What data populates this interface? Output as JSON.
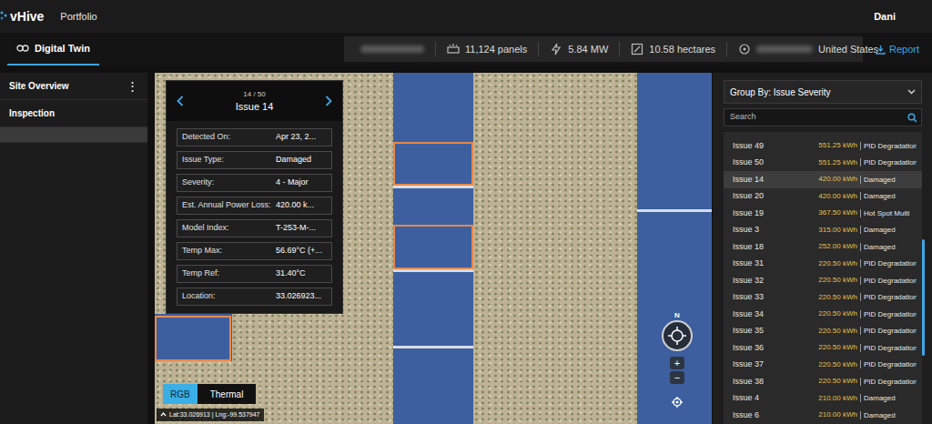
{
  "header": {
    "logo": "vHive",
    "nav": "Portfolio",
    "user": "Dani"
  },
  "toolbar": {
    "tab": {
      "label": "Digital Twin",
      "selected": true
    },
    "stats": [
      {
        "kind": "panels",
        "text": "11,124 panels"
      },
      {
        "kind": "power",
        "text": "5.84 MW"
      },
      {
        "kind": "area",
        "text": "10.58 hectares"
      },
      {
        "kind": "location",
        "text": "United States"
      }
    ],
    "report": "Report"
  },
  "sidebar": {
    "menu": "⋮",
    "items": [
      {
        "label": "Site Overview",
        "selected": false
      },
      {
        "label": "Inspection",
        "selected": false
      },
      {
        "label": "",
        "selected": true
      }
    ]
  },
  "issue_card": {
    "counter": "14 / 50",
    "title": "Issue 14",
    "fields": [
      {
        "label": "Detected On:",
        "value": "Apr 23, 2..."
      },
      {
        "label": "Issue Type:",
        "value": "Damaged"
      },
      {
        "label": "Severity:",
        "value": "4 - Major"
      },
      {
        "label": "Est. Annual Power Loss:",
        "value": "420.00 k..."
      },
      {
        "label": "Model Index:",
        "value": "T-253-M-..."
      },
      {
        "label": "Temp Max:",
        "value": "56.69°C (+..."
      },
      {
        "label": "Temp Ref:",
        "value": "31.40°C"
      },
      {
        "label": "Location:",
        "value": "33.026923..."
      }
    ]
  },
  "view_toggle": [
    {
      "label": "RGB",
      "selected": true
    },
    {
      "label": "Thermal",
      "selected": false
    }
  ],
  "coordinates": "Lat:33.026913 | Lng:-99.537947",
  "map_controls": {
    "north": "N",
    "zoom_in": "+",
    "zoom_out": "−"
  },
  "issues_panel": {
    "group_by": "Group By: Issue Severity",
    "search": {
      "placeholder": "Search"
    },
    "scroll": {
      "level": 0.4
    },
    "issues": [
      {
        "name": "Issue 49",
        "loss": "551.25 kWh",
        "type": "PID Degradation",
        "selected": false
      },
      {
        "name": "Issue 50",
        "loss": "551.25 kWh",
        "type": "PID Degradation",
        "selected": false
      },
      {
        "name": "Issue 14",
        "loss": "420.00 kWh",
        "type": "Damaged",
        "selected": true
      },
      {
        "name": "Issue 20",
        "loss": "420.00 kWh",
        "type": "Damaged",
        "selected": false
      },
      {
        "name": "Issue 19",
        "loss": "367.50 kWh",
        "type": "Hot Spot Multi",
        "selected": false
      },
      {
        "name": "Issue 3",
        "loss": "315.00 kWh",
        "type": "Damaged",
        "selected": false
      },
      {
        "name": "Issue 18",
        "loss": "252.00 kWh",
        "type": "Damaged",
        "selected": false
      },
      {
        "name": "Issue 31",
        "loss": "220.50 kWh",
        "type": "PID Degradation",
        "selected": false
      },
      {
        "name": "Issue 32",
        "loss": "220.50 kWh",
        "type": "PID Degradation",
        "selected": false
      },
      {
        "name": "Issue 33",
        "loss": "220.50 kWh",
        "type": "PID Degradation",
        "selected": false
      },
      {
        "name": "Issue 34",
        "loss": "220.50 kWh",
        "type": "PID Degradation",
        "selected": false
      },
      {
        "name": "Issue 35",
        "loss": "220.50 kWh",
        "type": "PID Degradation",
        "selected": false
      },
      {
        "name": "Issue 36",
        "loss": "220.50 kWh",
        "type": "PID Degradation",
        "selected": false
      },
      {
        "name": "Issue 37",
        "loss": "220.50 kWh",
        "type": "PID Degradation",
        "selected": false
      },
      {
        "name": "Issue 38",
        "loss": "220.50 kWh",
        "type": "PID Degradation",
        "selected": false
      },
      {
        "name": "Issue 4",
        "loss": "210.00 kWh",
        "type": "Damaged",
        "selected": false
      },
      {
        "name": "Issue 6",
        "loss": "210.00 kWh",
        "type": "Damaged",
        "selected": false
      }
    ]
  }
}
